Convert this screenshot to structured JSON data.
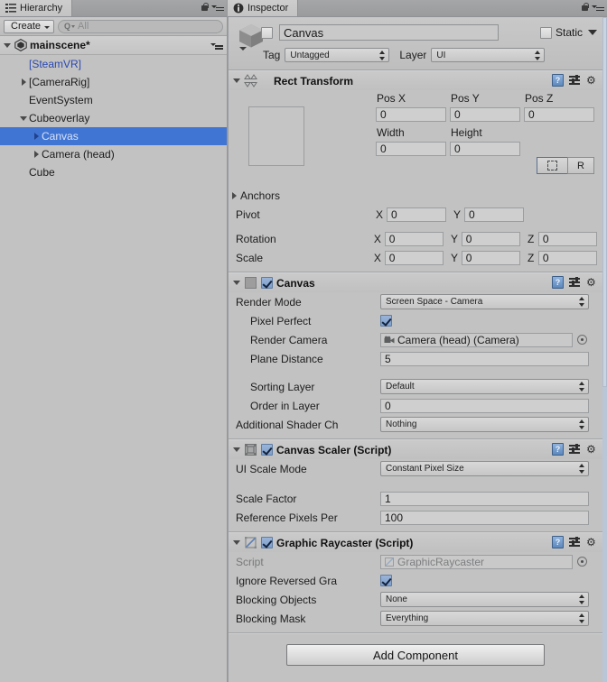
{
  "hierarchy": {
    "tab_label": "Hierarchy",
    "tab_icon": "hierarchy-icon",
    "create_button": "Create",
    "search_placeholder": "All",
    "scene_name": "mainscene*",
    "items": [
      {
        "label": "[SteamVR]",
        "indent": 1,
        "arrow": "none",
        "style": "prefab",
        "selected": false
      },
      {
        "label": "[CameraRig]",
        "indent": 1,
        "arrow": "closed",
        "style": "normal",
        "selected": false
      },
      {
        "label": "EventSystem",
        "indent": 1,
        "arrow": "none",
        "style": "normal",
        "selected": false
      },
      {
        "label": "Cubeoverlay",
        "indent": 1,
        "arrow": "open",
        "style": "normal",
        "selected": false
      },
      {
        "label": "Canvas",
        "indent": 2,
        "arrow": "closed",
        "style": "normal",
        "selected": true
      },
      {
        "label": "Camera (head)",
        "indent": 2,
        "arrow": "closed",
        "style": "normal",
        "selected": false
      },
      {
        "label": "Cube",
        "indent": 1,
        "arrow": "none",
        "style": "normal",
        "selected": false
      }
    ]
  },
  "inspector": {
    "tab_label": "Inspector",
    "tab_icon": "info-icon",
    "object": {
      "name": "Canvas",
      "enabled": false,
      "static_label": "Static",
      "static_checked": false,
      "tag_label": "Tag",
      "tag_value": "Untagged",
      "layer_label": "Layer",
      "layer_value": "UI"
    },
    "components": [
      {
        "title": "Rect Transform",
        "icon": "rect-transform-icon",
        "has_enable_checkbox": false,
        "expanded": true,
        "rect": {
          "pos_x_label": "Pos X",
          "pos_x": "0",
          "pos_y_label": "Pos Y",
          "pos_y": "0",
          "pos_z_label": "Pos Z",
          "pos_z": "0",
          "width_label": "Width",
          "width": "0",
          "height_label": "Height",
          "height": "0",
          "blueprint_button": "blueprint-icon",
          "raw_button": "R",
          "anchors_label": "Anchors",
          "pivot_label": "Pivot",
          "pivot_x": "0",
          "pivot_y": "0",
          "rotation_label": "Rotation",
          "rotation_x": "0",
          "rotation_y": "0",
          "rotation_z": "0",
          "scale_label": "Scale",
          "scale_x": "0",
          "scale_y": "0",
          "scale_z": "0",
          "axis_x": "X",
          "axis_y": "Y",
          "axis_z": "Z"
        }
      },
      {
        "title": "Canvas",
        "icon": "canvas-icon",
        "has_enable_checkbox": true,
        "enabled": true,
        "expanded": true,
        "fields": [
          {
            "type": "dropdown",
            "label": "Render Mode",
            "value": "Screen Space - Camera",
            "indent": 0
          },
          {
            "type": "checkbox",
            "label": "Pixel Perfect",
            "value": true,
            "indent": 1
          },
          {
            "type": "object",
            "label": "Render Camera",
            "value": "Camera (head) (Camera)",
            "icon": "camera-icon",
            "indent": 1
          },
          {
            "type": "text",
            "label": "Plane Distance",
            "value": "5",
            "indent": 1
          },
          {
            "type": "spacer"
          },
          {
            "type": "dropdown",
            "label": "Sorting Layer",
            "value": "Default",
            "indent": 1
          },
          {
            "type": "text",
            "label": "Order in Layer",
            "value": "0",
            "indent": 1
          },
          {
            "type": "dropdown",
            "label": "Additional Shader Ch",
            "value": "Nothing",
            "indent": 0
          }
        ]
      },
      {
        "title": "Canvas Scaler (Script)",
        "icon": "canvas-scaler-icon",
        "has_enable_checkbox": true,
        "enabled": true,
        "expanded": true,
        "fields": [
          {
            "type": "dropdown",
            "label": "UI Scale Mode",
            "value": "Constant Pixel Size",
            "indent": 0
          },
          {
            "type": "spacer"
          },
          {
            "type": "text",
            "label": "Scale Factor",
            "value": "1",
            "indent": 0
          },
          {
            "type": "text",
            "label": "Reference Pixels Per",
            "value": "100",
            "indent": 0
          }
        ]
      },
      {
        "title": "Graphic Raycaster (Script)",
        "icon": "graphic-raycaster-icon",
        "has_enable_checkbox": true,
        "enabled": true,
        "expanded": true,
        "fields": [
          {
            "type": "object",
            "label": "Script",
            "value": "GraphicRaycaster",
            "icon": "script-icon",
            "disabled": true,
            "indent": 0
          },
          {
            "type": "checkbox",
            "label": "Ignore Reversed Gra",
            "value": true,
            "indent": 0
          },
          {
            "type": "dropdown",
            "label": "Blocking Objects",
            "value": "None",
            "indent": 0
          },
          {
            "type": "dropdown",
            "label": "Blocking Mask",
            "value": "Everything",
            "indent": 0
          }
        ]
      }
    ],
    "add_component_label": "Add Component"
  },
  "colors": {
    "panel_bg": "#c2c2c2",
    "selection_blue": "#4175d4",
    "prefab_blue": "#2b48b0",
    "checkbox_blue": "#7d9fcc"
  }
}
